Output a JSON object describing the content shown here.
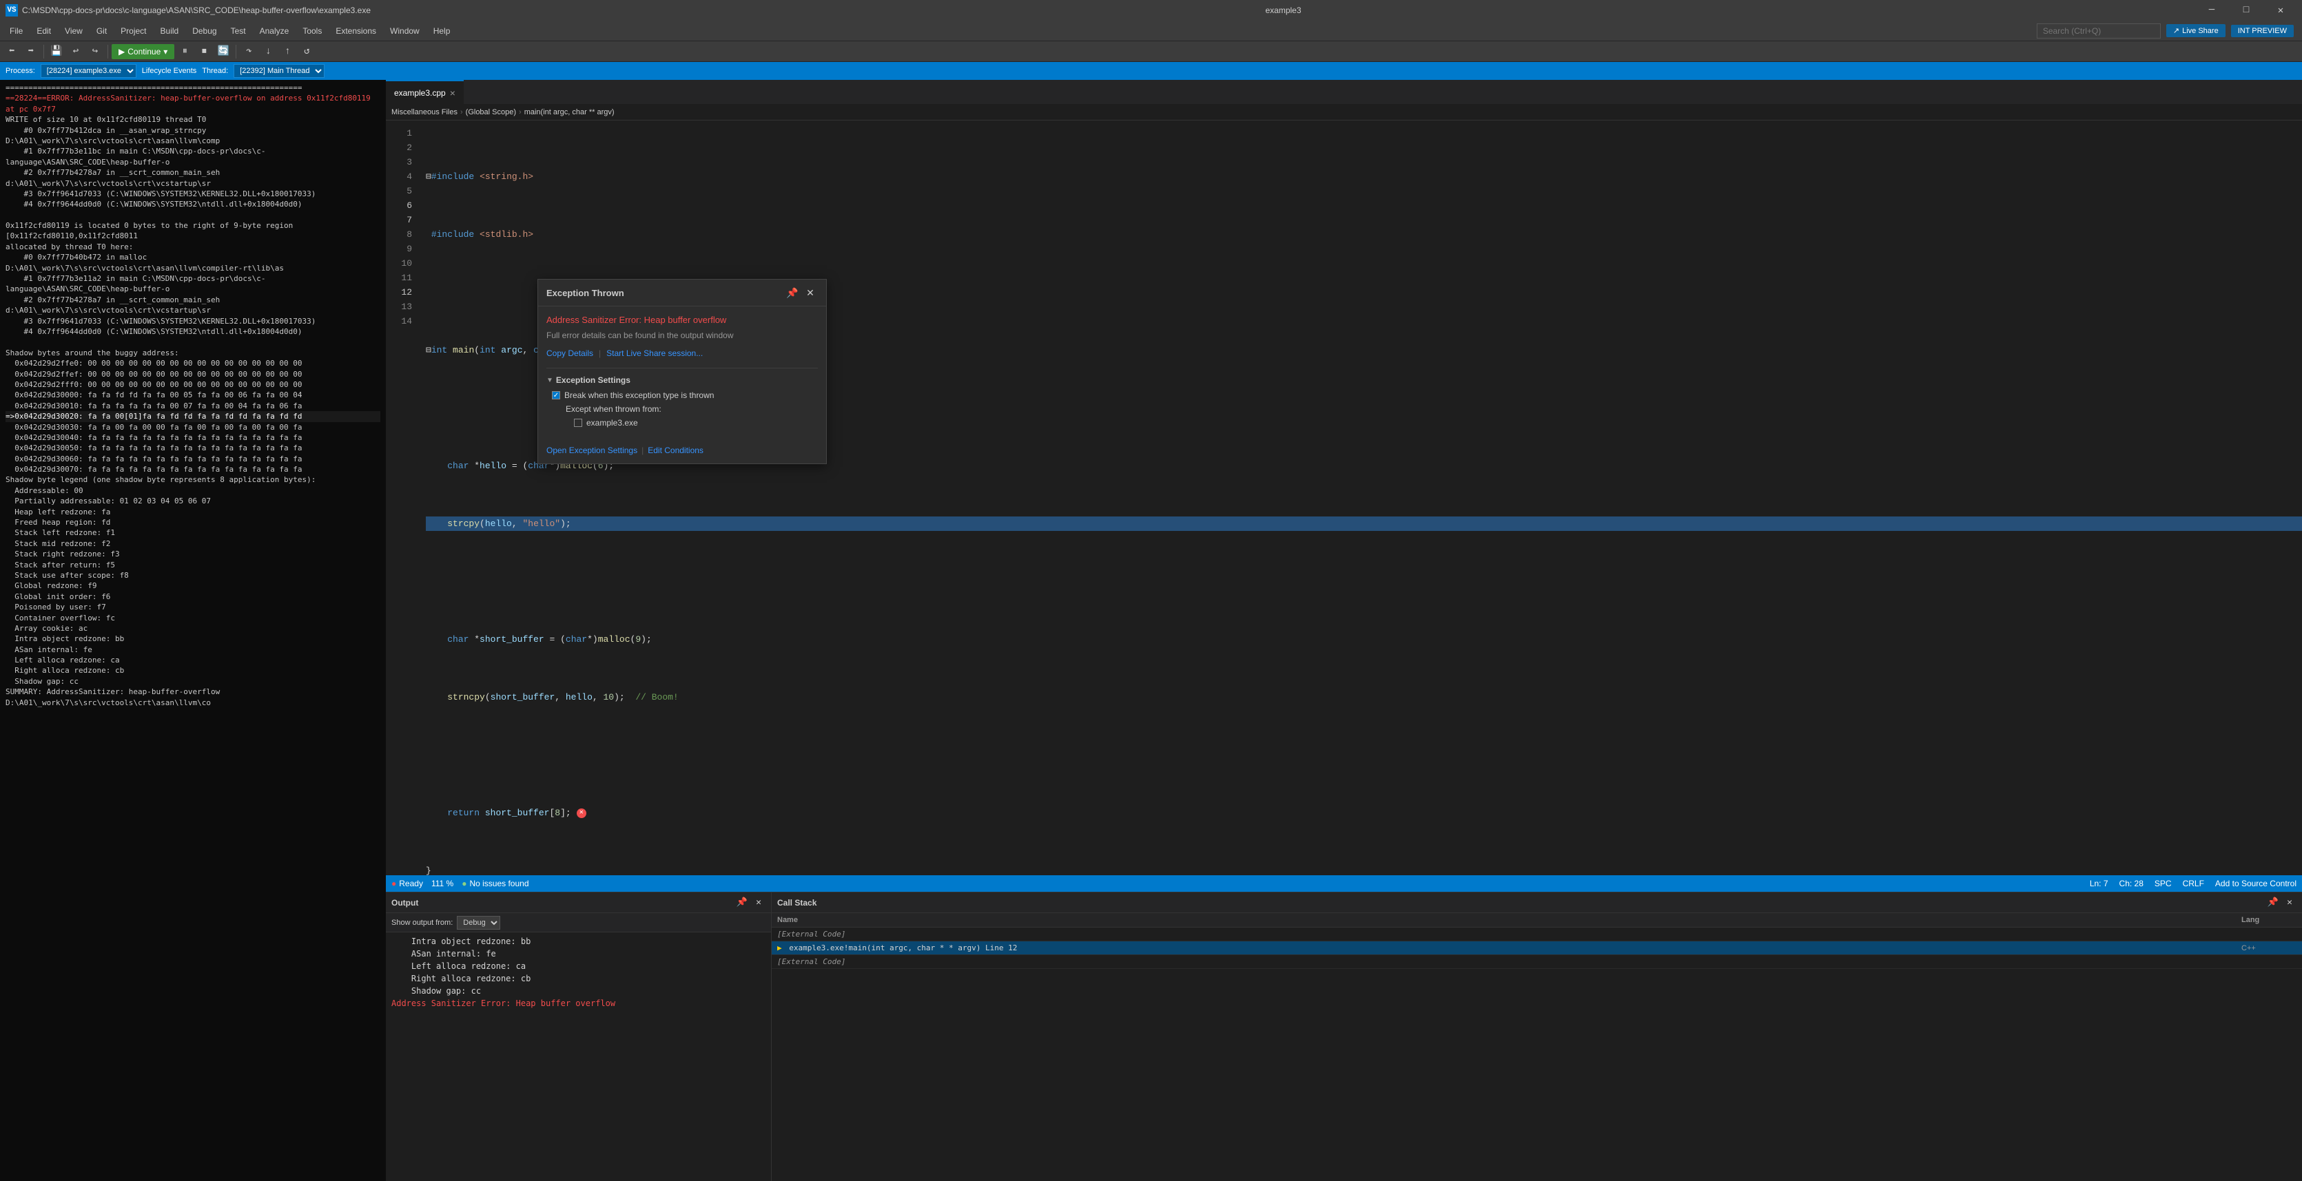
{
  "titlebar": {
    "path": "C:\\MSDN\\cpp-docs-pr\\docs\\c-language\\ASAN\\SRC_CODE\\heap-buffer-overflow\\example3.exe",
    "title": "example3",
    "minimize": "─",
    "maximize": "□",
    "close": "✕"
  },
  "menubar": {
    "items": [
      "File",
      "Edit",
      "View",
      "Git",
      "Project",
      "Build",
      "Debug",
      "Test",
      "Analyze",
      "Tools",
      "Extensions",
      "Window",
      "Help"
    ]
  },
  "toolbar": {
    "continue_label": "Continue",
    "continue_dropdown": "▾"
  },
  "processbar": {
    "label": "Process:",
    "process": "[28224] example3.exe",
    "lifecycle_label": "Lifecycle Events",
    "thread_label": "Thread:",
    "thread": "[22392] Main Thread"
  },
  "editor": {
    "tab_label": "example3.cpp",
    "breadcrumb_files": "Miscellaneous Files",
    "breadcrumb_scope": "(Global Scope)",
    "breadcrumb_func": "main(int argc, char ** argv)",
    "lines": [
      {
        "num": 1,
        "code": "#include <string.h>"
      },
      {
        "num": 2,
        "code": "#include <stdlib.h>"
      },
      {
        "num": 3,
        "code": ""
      },
      {
        "num": 4,
        "code": "int main(int argc, char **argv) {"
      },
      {
        "num": 5,
        "code": ""
      },
      {
        "num": 6,
        "code": "    char *hello = (char*)malloc(6);"
      },
      {
        "num": 7,
        "code": "    strcpy(hello, \"hello\");",
        "highlight": true
      },
      {
        "num": 8,
        "code": ""
      },
      {
        "num": 9,
        "code": "    char *short_buffer = (char*)malloc(9);"
      },
      {
        "num": 10,
        "code": "    strncpy(short_buffer, hello, 10);  // Boom!"
      },
      {
        "num": 11,
        "code": ""
      },
      {
        "num": 12,
        "code": "    return short_buffer[8];",
        "error": true
      },
      {
        "num": 13,
        "code": "}"
      },
      {
        "num": 14,
        "code": ""
      }
    ]
  },
  "exception_popup": {
    "title": "Exception Thrown",
    "message": "Address Sanitizer Error: Heap buffer overflow",
    "detail": "Full error details can be found in the output window",
    "copy_details": "Copy Details",
    "start_live_share": "Start Live Share session...",
    "settings_title": "Exception Settings",
    "break_when": "Break when this exception type is thrown",
    "except_when": "Except when thrown from:",
    "example_exe": "example3.exe",
    "open_settings": "Open Exception Settings",
    "edit_conditions": "Edit Conditions",
    "pin": "📌",
    "close": "✕"
  },
  "statusbar": {
    "left_icon": "●",
    "status_text": "Ready",
    "no_issues": "No issues found",
    "zoom": "111 %",
    "ln": "Ln: 7",
    "ch": "Ch: 28",
    "spc": "SPC",
    "crlf": "CRLF",
    "add_source": "Add to Source Control",
    "bell": "🔔"
  },
  "output_panel": {
    "title": "Output",
    "show_label": "Show output from:",
    "source": "Debug",
    "content": [
      "    Intra object redzone:    bb",
      "    ASan internal:           fe",
      "    Left alloca redzone:     ca",
      "    Right alloca redzone:    cb",
      "    Shadow gap:              cc",
      "Address Sanitizer Error: Heap buffer overflow"
    ]
  },
  "callstack_panel": {
    "title": "Call Stack",
    "col_name": "Name",
    "col_lang": "Lang",
    "rows": [
      {
        "name": "[External Code]",
        "lang": "",
        "external": true,
        "active": false
      },
      {
        "name": "example3.exe!main(int argc, char * * argv) Line 12",
        "lang": "C++",
        "external": false,
        "active": true,
        "arrow": true
      },
      {
        "name": "[External Code]",
        "lang": "",
        "external": true,
        "active": false
      }
    ]
  },
  "terminal": {
    "lines": [
      "=================================================================",
      "==28224==ERROR: AddressSanitizer: heap-buffer-overflow on address 0x11f2cfd80119 at pc 0x7f7",
      "WRITE of size 10 at 0x11f2cfd80119 thread T0",
      "    #0 0x7ff77b412dca in __asan_wrap_strncpy D:\\A01\\_work\\7\\s\\src\\vctools\\crt\\asan\\llvm\\comp",
      "    #1 0x7ff77b3e11bc in main C:\\MSDN\\cpp-docs-pr\\docs\\c-language\\ASAN\\SRC_CODE\\heap-buffer-o",
      "    #2 0x7ff77b4278a7 in __scrt_common_main_seh d:\\A01\\_work\\7\\s\\src\\vctools\\crt\\vcstartup\\sr",
      "    #3 0x7ff9641d7033  (C:\\WINDOWS\\SYSTEM32\\KERNEL32.DLL+0x180017033)",
      "    #4 0x7ff9644dd0d0  (C:\\WINDOWS\\SYSTEM32\\ntdll.dll+0x18004d0d0)",
      "",
      "0x11f2cfd80119 is located 0 bytes to the right of 9-byte region [0x11f2cfd80110,0x11f2cfd8011",
      "allocated by thread T0 here:",
      "    #0 0x7ff77b40b472 in malloc D:\\A01\\_work\\7\\s\\src\\vctools\\crt\\asan\\llvm\\compiler-rt\\lib\\as",
      "    #1 0x7ff77b3e11a2 in main C:\\MSDN\\cpp-docs-pr\\docs\\c-language\\ASAN\\SRC_CODE\\heap-buffer-o",
      "    #2 0x7ff77b4278a7 in __scrt_common_main_seh d:\\A01\\_work\\7\\s\\src\\vctools\\crt\\vcstartup\\sr",
      "    #3 0x7ff9641d7033  (C:\\WINDOWS\\SYSTEM32\\KERNEL32.DLL+0x180017033)",
      "    #4 0x7ff9644dd0d0  (C:\\WINDOWS\\SYSTEM32\\ntdll.dll+0x18004d0d0)",
      "",
      "Shadow bytes around the buggy address:",
      "  0x042d29d2ffe0: 00 00 00 00 00 00 00 00 00 00 00 00 00 00 00 00",
      "  0x042d29d2ffef: 00 00 00 00 00 00 00 00 00 00 00 00 00 00 00 00",
      "  0x042d29d2fff0: 00 00 00 00 00 00 00 00 00 00 00 00 00 00 00 00",
      "  0x042d29d30000: fa fa fd fd fa fa 00 05 fa fa 00 06 fa fa 00 04",
      "  0x042d29d30010: fa fa fa fa fa fa 00 07 fa fa 00 04 fa fa 06 fa",
      "=>0x042d29d30020: fa fa 00[01]fa fa fd fd fa fa fd fd fa fa fd fd",
      "  0x042d29d30030: fa fa 00 fa 00 00 fa fa 00 fa 00 fa 00 fa 00 fa",
      "  0x042d29d30040: fa fa fa fa fa fa fa fa fa fa fa fa fa fa fa fa",
      "  0x042d29d30050: fa fa fa fa fa fa fa fa fa fa fa fa fa fa fa fa",
      "  0x042d29d30060: fa fa fa fa fa fa fa fa fa fa fa fa fa fa fa fa",
      "  0x042d29d30070: fa fa fa fa fa fa fa fa fa fa fa fa fa fa fa fa",
      "Shadow byte legend (one shadow byte represents 8 application bytes):",
      "  Addressable:           00",
      "  Partially addressable: 01 02 03 04 05 06 07",
      "  Heap left redzone:       fa",
      "  Freed heap region:       fd",
      "  Stack left redzone:      f1",
      "  Stack mid redzone:       f2",
      "  Stack right redzone:     f3",
      "  Stack after return:      f5",
      "  Stack use after scope:   f8",
      "  Global redzone:          f9",
      "  Global init order:       f6",
      "  Poisoned by user:        f7",
      "  Container overflow:      fc",
      "  Array cookie:            ac",
      "  Intra object redzone:    bb",
      "  ASan internal:           fe",
      "  Left alloca redzone:     ca",
      "  Right alloca redzone:    cb",
      "  Shadow gap:              cc",
      "SUMMARY: AddressSanitizer: heap-buffer-overflow D:\\A01\\_work\\7\\s\\src\\vctools\\crt\\asan\\llvm\\co"
    ]
  },
  "activity_bar": {
    "items": [
      "≡",
      "⚙",
      "👤"
    ]
  },
  "search": {
    "placeholder": "Search (Ctrl+Q)"
  },
  "live_share": {
    "label": "Live Share"
  },
  "int_preview": {
    "label": "INT PREVIEW"
  }
}
